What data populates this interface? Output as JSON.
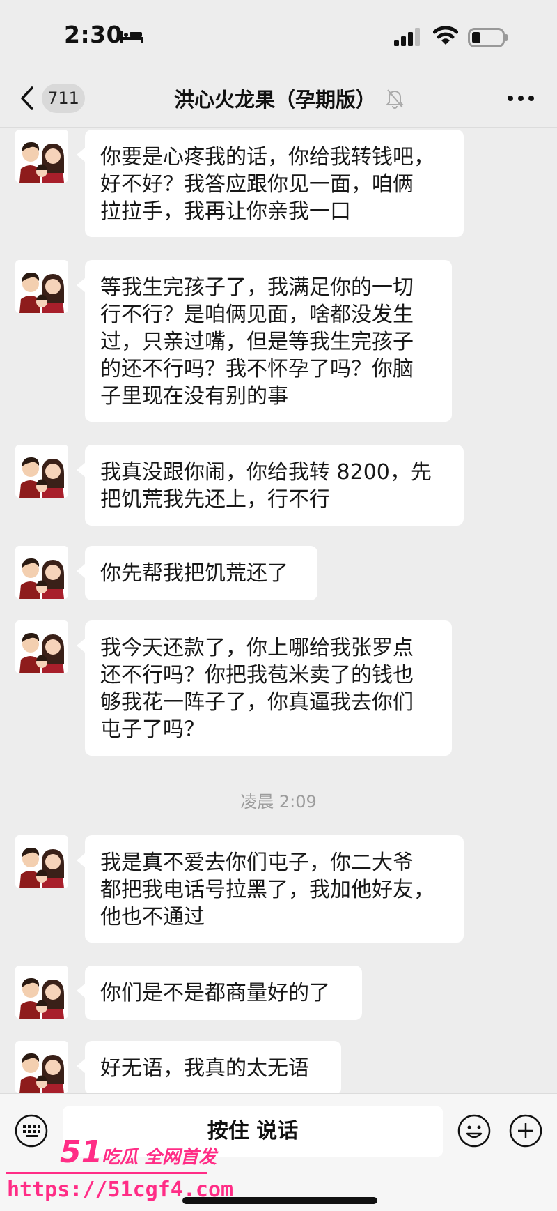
{
  "status_bar": {
    "time": "2:30"
  },
  "nav": {
    "unread_count": "711",
    "title": "洪心火龙果（孕期版）"
  },
  "messages": [
    {
      "lines": [
        "你要是心疼我的话，你给我转钱吧，",
        "好不好？我答应跟你见一面，咱俩",
        "拉拉手，我再让你亲我一口"
      ]
    },
    {
      "lines": [
        "等我生完孩子了，我满足你的一切",
        "行不行？是咱俩见面，啥都没发生",
        "过，只亲过嘴，但是等我生完孩子",
        "的还不行吗？我不怀孕了吗？你脑",
        "子里现在没有别的事"
      ]
    },
    {
      "lines": [
        "我真没跟你闹，你给我转 8200，先",
        "把饥荒我先还上，行不行"
      ]
    },
    {
      "lines": [
        "你先帮我把饥荒还了"
      ]
    },
    {
      "lines": [
        "我今天还款了，你上哪给我张罗点",
        "还不行吗？你把我苞米卖了的钱也",
        "够我花一阵子了，你真逼我去你们",
        "屯子了吗？"
      ]
    },
    {
      "lines": [
        "我是真不爱去你们屯子，你二大爷",
        "都把我电话号拉黑了，我加他好友，",
        "他也不通过"
      ]
    },
    {
      "lines": [
        "你们是不是都商量好的了"
      ]
    },
    {
      "lines": [
        "好无语，我真的太无语"
      ]
    }
  ],
  "time_divider": "凌晨 2:09",
  "input_bar": {
    "hold_to_talk_label": "按住 说话"
  },
  "watermark": {
    "logo": "51",
    "slogan": "吃瓜 全网首发",
    "url": "https://51cgf4.com"
  },
  "colors": {
    "background": "#ededed",
    "bubble": "#ffffff",
    "watermark": "#ff2d86"
  }
}
